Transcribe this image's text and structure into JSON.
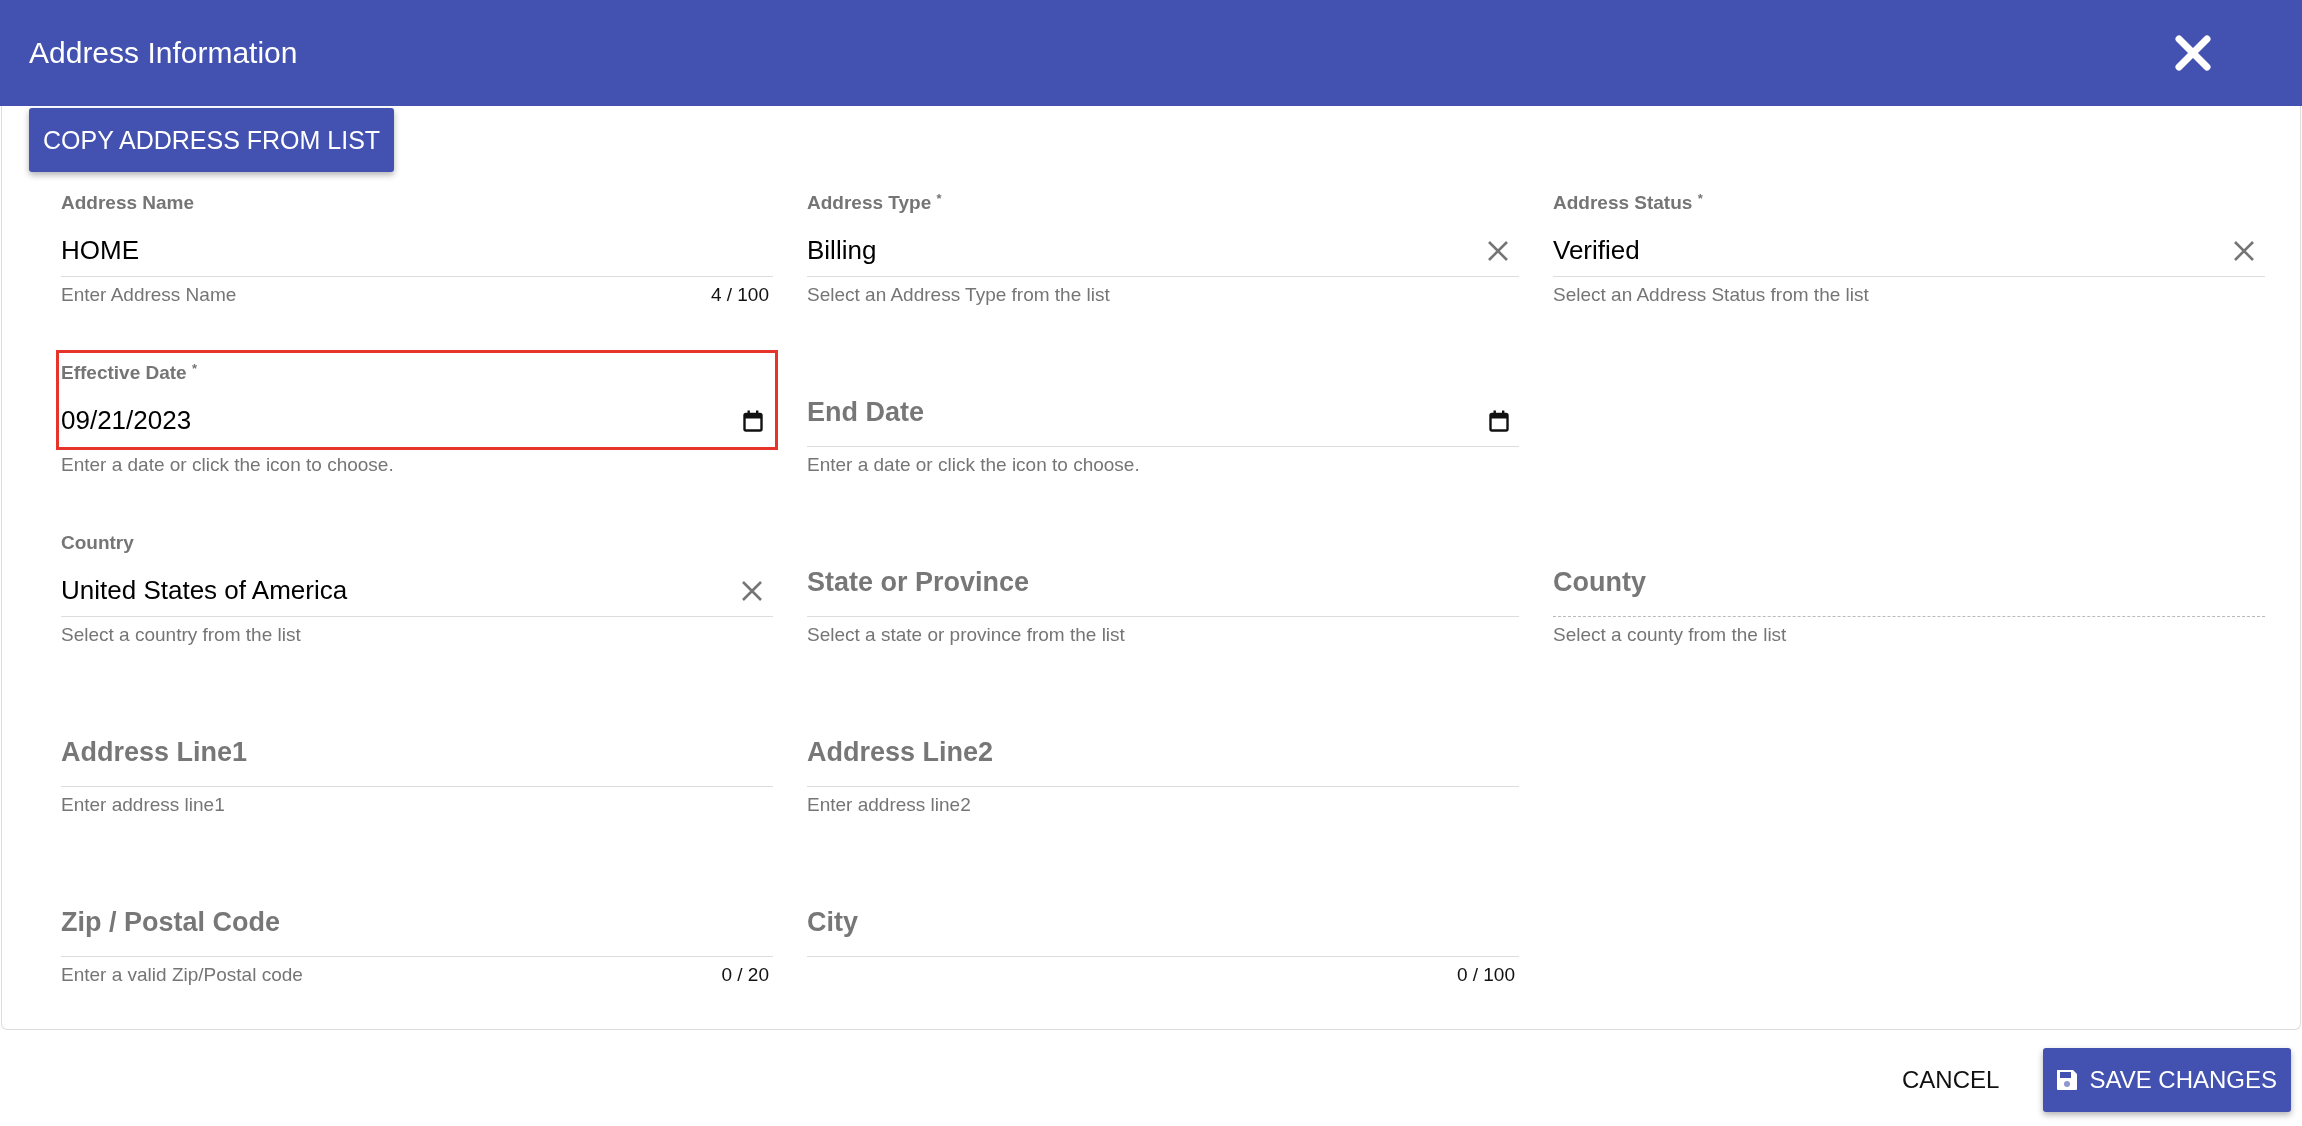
{
  "dialog": {
    "title": "Address Information"
  },
  "copy_button": "COPY ADDRESS FROM LIST",
  "rows": [
    [
      {
        "kind": "text",
        "label": "Address Name",
        "value": "HOME",
        "helper": "Enter Address Name",
        "counter": "4 / 100",
        "highlighted": false,
        "disabled": false
      },
      {
        "kind": "select",
        "label": "Address Type $^{*}$",
        "value": "Billing",
        "helper": "Select an Address Type from the list",
        "highlighted": false,
        "disabled": false
      },
      {
        "kind": "select",
        "label": "Address Status $^{*}$",
        "value": "Verified",
        "helper": "Select an Address Status from the list",
        "highlighted": false,
        "disabled": false
      }
    ],
    [
      {
        "kind": "date",
        "label": "Effective Date $^{*}$",
        "value": "09/21/2023",
        "helper": "Enter a date or click the icon to choose.",
        "highlighted": true,
        "disabled": false
      },
      {
        "kind": "date",
        "label": "End Date",
        "helper": "Enter a date or click the icon to choose.",
        "highlighted": false,
        "disabled": false
      }
    ],
    [
      {
        "kind": "select",
        "label": "Country",
        "value": "United States of America",
        "helper": "Select a country from the list",
        "highlighted": false,
        "disabled": false
      },
      {
        "kind": "select",
        "label": "State or Province",
        "helper": "Select a state or province from the list",
        "highlighted": false,
        "disabled": false
      },
      {
        "kind": "select",
        "label": "County",
        "helper": "Select a county from the list",
        "highlighted": false,
        "disabled": true
      }
    ],
    [
      {
        "kind": "text",
        "label": "Address Line1",
        "helper": "Enter address line1",
        "highlighted": false,
        "disabled": false
      },
      {
        "kind": "text",
        "label": "Address Line2",
        "helper": "Enter address line2",
        "highlighted": false,
        "disabled": false
      }
    ],
    [
      {
        "kind": "text",
        "label": "Zip / Postal Code",
        "helper": "Enter a valid Zip/Postal code",
        "counter": "0 / 20",
        "highlighted": false,
        "disabled": false
      },
      {
        "kind": "text",
        "label": "City",
        "counter": "0 / 100",
        "highlighted": false,
        "disabled": false
      }
    ]
  ],
  "footer": {
    "cancel": "CANCEL",
    "save": "SAVE CHANGES"
  }
}
